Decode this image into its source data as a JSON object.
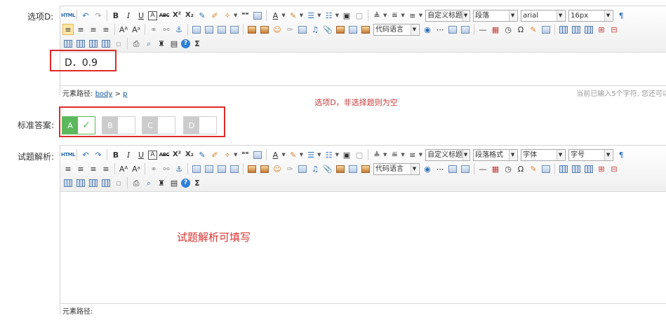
{
  "option_d": {
    "label": "选项D:",
    "content": "D．0.9",
    "elempath_label": "元素路径:",
    "elempath_body": "body",
    "elempath_sep": ">",
    "elempath_p": "p",
    "wordcount": "当前已输入5个字符, 您还可以输"
  },
  "option_hint": "选项D，非选择题则为空",
  "standard_answer": {
    "label": "标准答案:",
    "options": [
      {
        "letter": "A",
        "selected": true,
        "mark": "✓"
      },
      {
        "letter": "B",
        "selected": false,
        "mark": ""
      },
      {
        "letter": "C",
        "selected": false,
        "mark": ""
      },
      {
        "letter": "D",
        "selected": false,
        "mark": ""
      }
    ]
  },
  "analysis": {
    "label": "试题解析:",
    "placeholder_text": "试题解析可填写",
    "elempath_label": "元素路径:"
  },
  "toolbar": {
    "html": "HTML",
    "bold": "B",
    "italic": "I",
    "underline": "U",
    "fontborder": "A",
    "strike": "ABC",
    "superscript": "X²",
    "subscript": "X₂",
    "quote": "❝❝",
    "forecolor": "A",
    "custom_heading": "自定义标题",
    "code_lang": "代码语言",
    "sigma": "Σ",
    "omega": "Ω",
    "help": "?",
    "editor1": {
      "paragraph": "段落",
      "font": "arial",
      "size": "16px"
    },
    "editor2": {
      "paragraph": "段落格式",
      "font": "字体",
      "size": "字号"
    }
  }
}
